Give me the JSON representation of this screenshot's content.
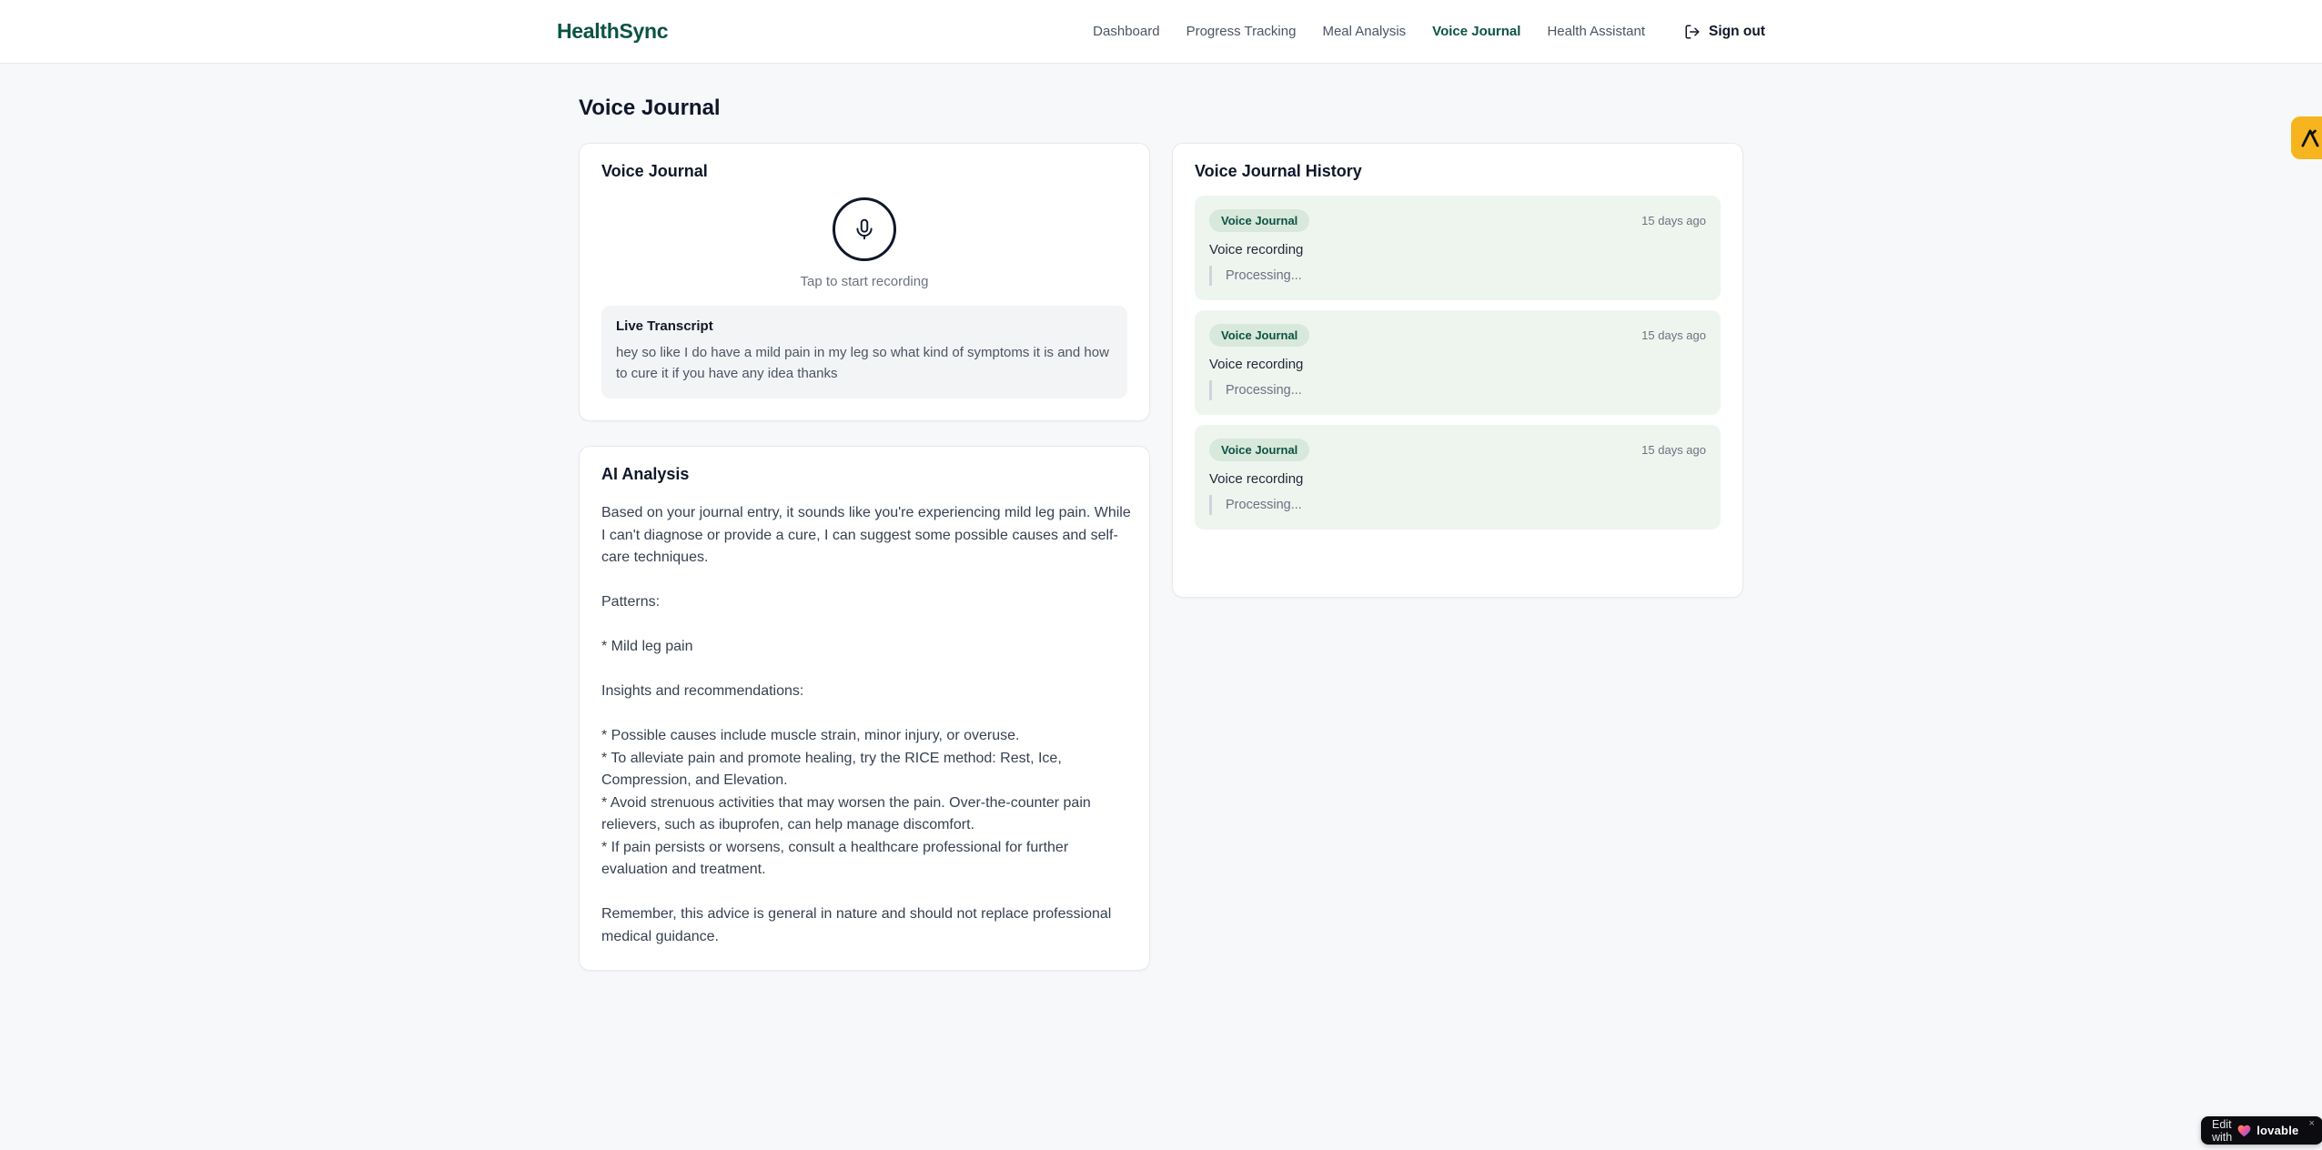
{
  "header": {
    "logo": "HealthSync",
    "nav": [
      {
        "label": "Dashboard",
        "active": false
      },
      {
        "label": "Progress Tracking",
        "active": false
      },
      {
        "label": "Meal Analysis",
        "active": false
      },
      {
        "label": "Voice Journal",
        "active": true
      },
      {
        "label": "Health Assistant",
        "active": false
      }
    ],
    "sign_out": {
      "label": "Sign out"
    }
  },
  "page": {
    "title": "Voice Journal"
  },
  "recorder": {
    "title": "Voice Journal",
    "tap_hint": "Tap to start recording",
    "transcript": {
      "title": "Live Transcript",
      "text": "hey so like I do have a mild pain in my leg so what kind of symptoms it is and how to cure it if you have any idea thanks"
    }
  },
  "analysis": {
    "title": "AI Analysis",
    "body": "Based on your journal entry, it sounds like you're experiencing mild leg pain. While I can't diagnose or provide a cure, I can suggest some possible causes and self-care techniques.\n\nPatterns:\n\n* Mild leg pain\n\nInsights and recommendations:\n\n* Possible causes include muscle strain, minor injury, or overuse.\n* To alleviate pain and promote healing, try the RICE method: Rest, Ice, Compression, and Elevation.\n* Avoid strenuous activities that may worsen the pain. Over-the-counter pain relievers, such as ibuprofen, can help manage discomfort.\n* If pain persists or worsens, consult a healthcare professional for further evaluation and treatment.\n\nRemember, this advice is general in nature and should not replace professional medical guidance."
  },
  "history": {
    "title": "Voice Journal History",
    "entries": [
      {
        "badge": "Voice Journal",
        "time": "15 days ago",
        "label": "Voice recording",
        "status": "Processing..."
      },
      {
        "badge": "Voice Journal",
        "time": "15 days ago",
        "label": "Voice recording",
        "status": "Processing..."
      },
      {
        "badge": "Voice Journal",
        "time": "15 days ago",
        "label": "Voice recording",
        "status": "Processing..."
      }
    ]
  },
  "overlays": {
    "lovable": {
      "prefix": "Edit with",
      "brand": "lovable",
      "close": "×"
    }
  },
  "colors": {
    "brand_green": "#0b5345",
    "page_background": "#f7f8fa",
    "card_border": "#e7e9ee",
    "history_entry_background": "#eef5ef",
    "badge_background": "#d8e8da",
    "transcript_background": "#f3f4f6",
    "side_badge_amber": "#f6b51e",
    "lovable_black": "#0c0c10"
  }
}
